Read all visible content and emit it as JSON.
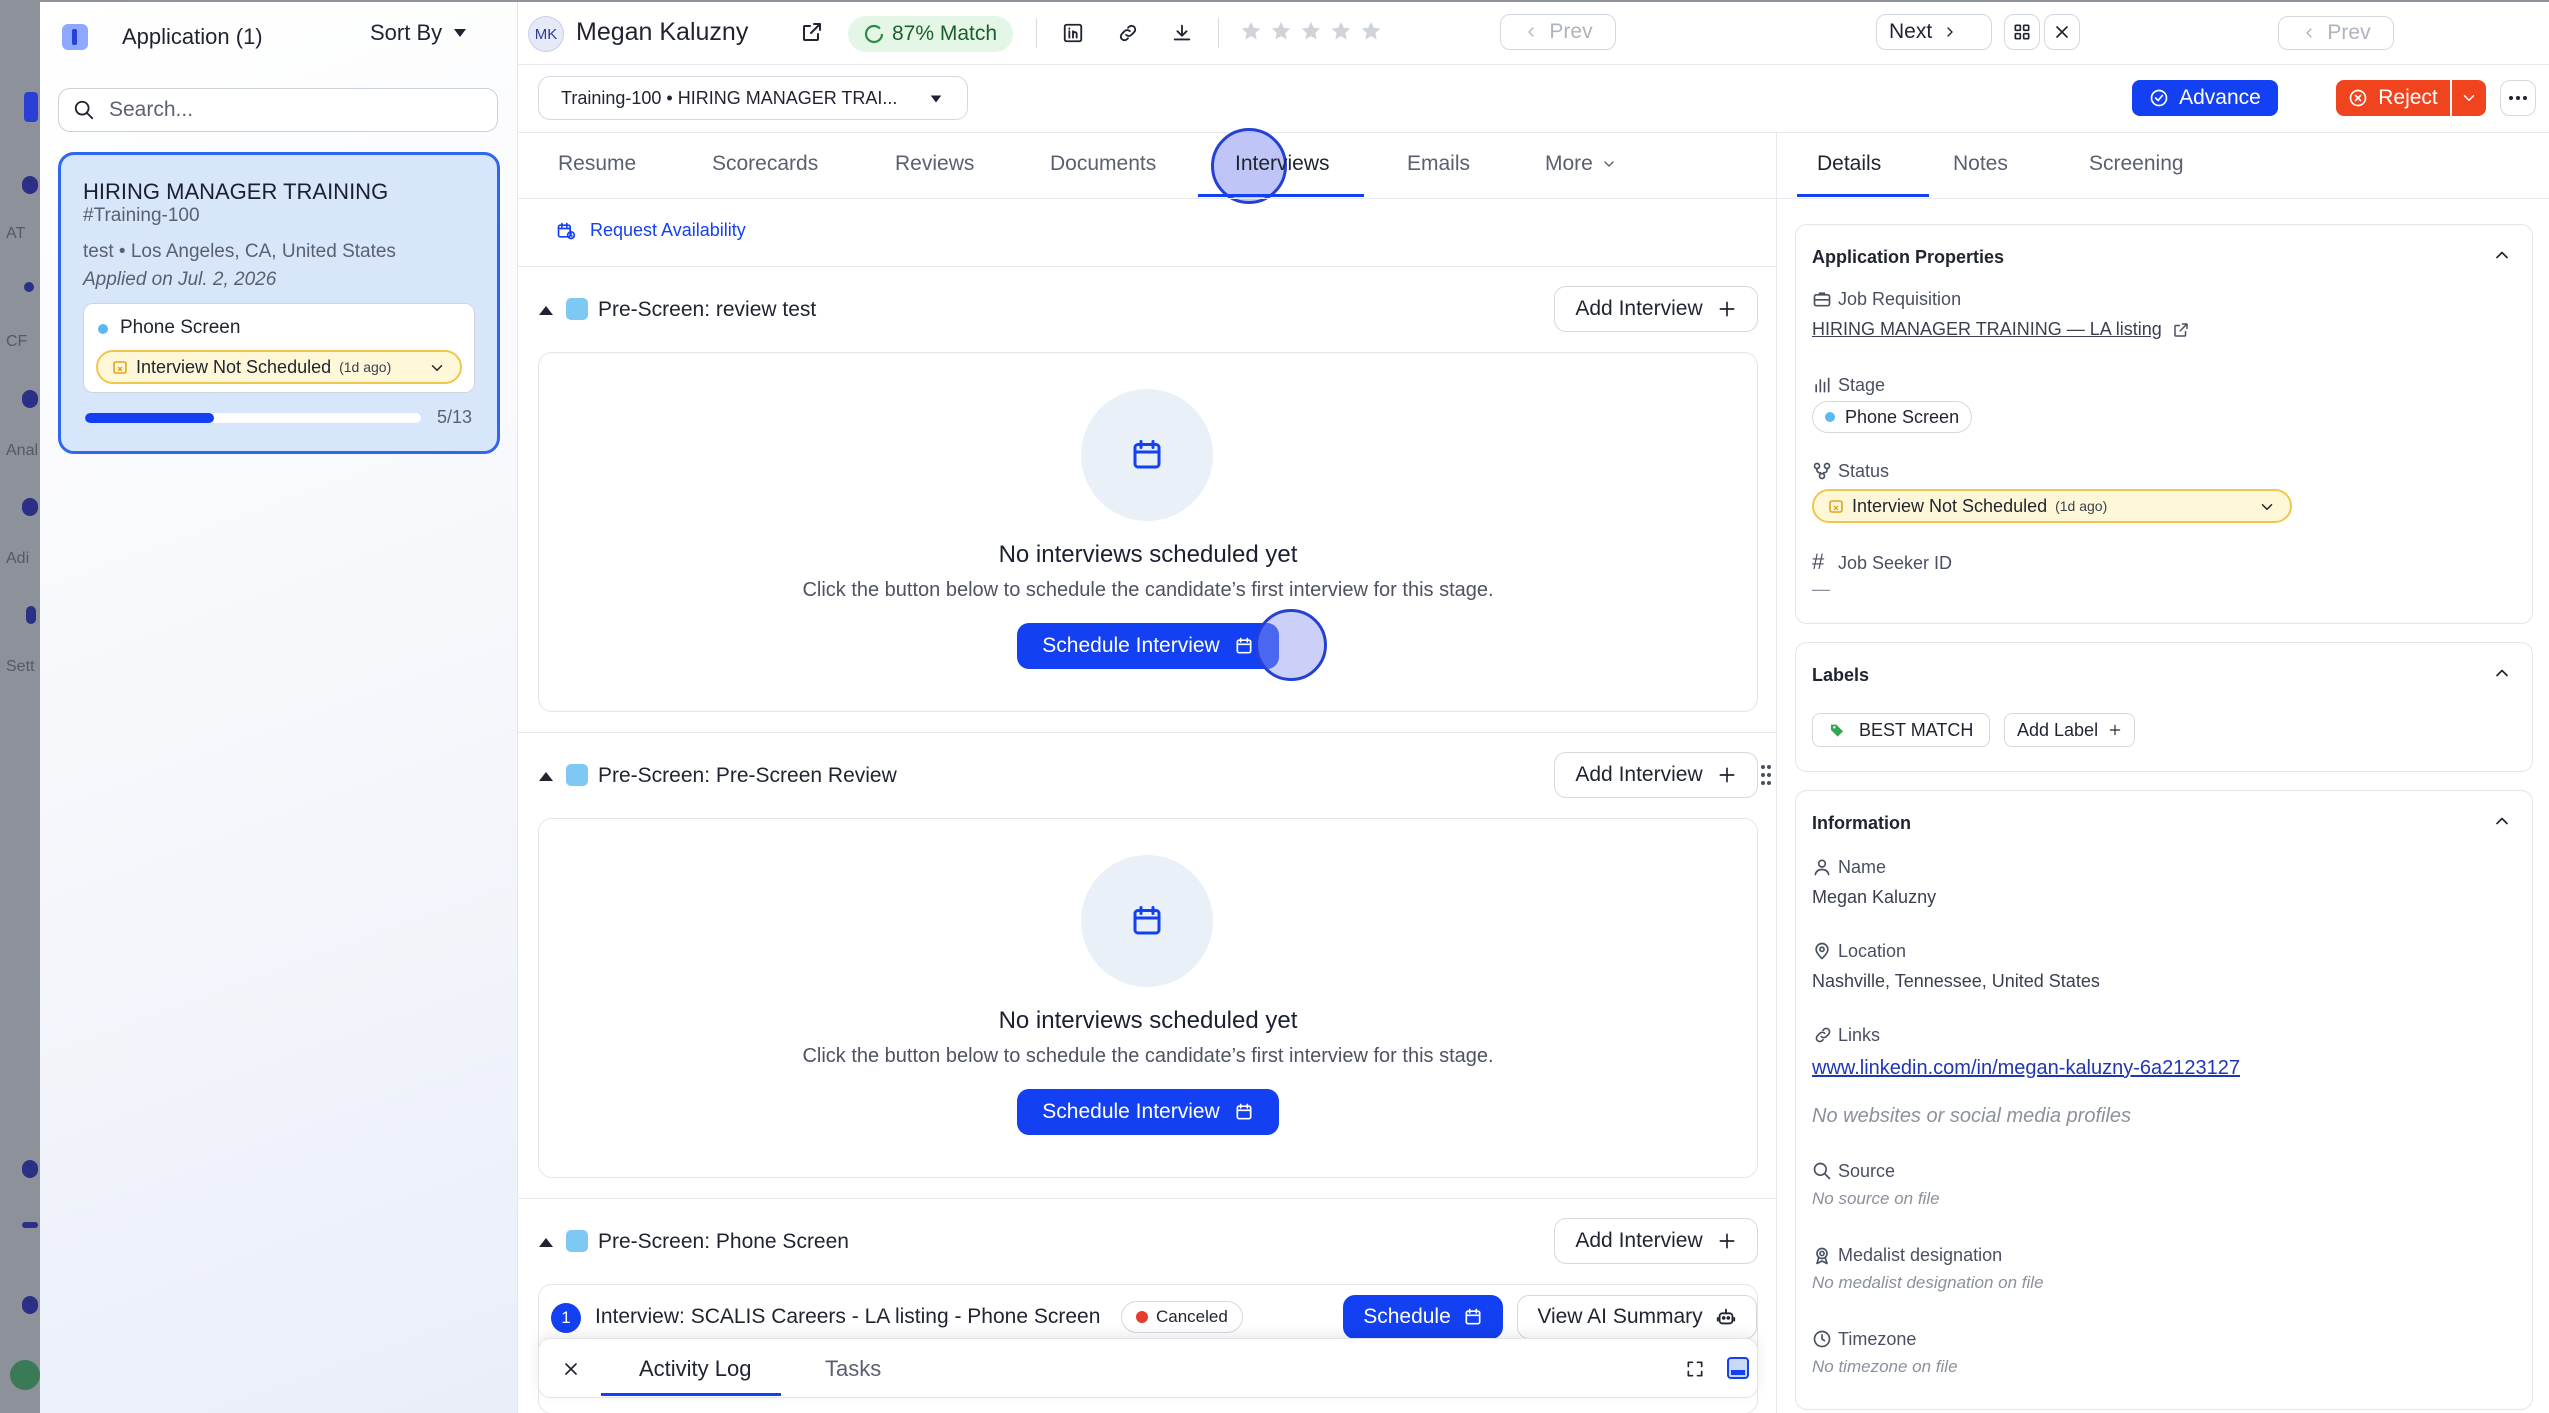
{
  "rail": {
    "labels": [
      "AT",
      "CF",
      "Anal",
      "Adi",
      "Sett"
    ]
  },
  "left": {
    "header_title": "Application (1)",
    "sort_label": "Sort By",
    "search_placeholder": "Search...",
    "app_card": {
      "title": "HIRING MANAGER TRAINING",
      "code": "#Training-100",
      "location": "test • Los Angeles, CA, United States",
      "applied": "Applied on Jul. 2, 2026",
      "stage": "Phone Screen",
      "status": "Interview Not Scheduled",
      "status_age": "(1d ago)",
      "progress_label": "5/13",
      "progress_fraction": 0.385
    }
  },
  "header": {
    "initials": "MK",
    "name": "Megan Kaluzny",
    "match": "87% Match",
    "prev_label": "Prev",
    "next_label": "Next",
    "star_count": 5,
    "job_select": "Training-100 • HIRING MANAGER TRAI...",
    "advance_label": "Advance",
    "reject_label": "Reject"
  },
  "tabs": [
    "Resume",
    "Scorecards",
    "Reviews",
    "Documents",
    "Interviews",
    "Emails",
    "More"
  ],
  "active_tab": "Interviews",
  "request_availability": "Request Availability",
  "stages": [
    {
      "title": "Pre-Screen: review test",
      "add_label": "Add Interview",
      "empty_title": "No interviews scheduled yet",
      "empty_text": "Click the button below to schedule the candidate’s first interview for this stage.",
      "schedule_label": "Schedule Interview"
    },
    {
      "title": "Pre-Screen: Pre-Screen Review",
      "add_label": "Add Interview",
      "empty_title": "No interviews scheduled yet",
      "empty_text": "Click the button below to schedule the candidate’s first interview for this stage.",
      "schedule_label": "Schedule Interview"
    },
    {
      "title": "Pre-Screen: Phone Screen",
      "add_label": "Add Interview"
    }
  ],
  "interview_row": {
    "number": "1",
    "title": "Interview: SCALIS Careers - LA listing - Phone Screen",
    "badge": "Canceled",
    "schedule_label": "Schedule",
    "summary_label": "View AI Summary"
  },
  "bottom_bar": {
    "tabs": [
      "Activity Log",
      "Tasks"
    ],
    "active": "Activity Log"
  },
  "right_tabs": [
    "Details",
    "Notes",
    "Screening"
  ],
  "right_active": "Details",
  "app_props": {
    "title": "Application Properties",
    "job_req_label": "Job Requisition",
    "job_req_value": "HIRING MANAGER TRAINING — LA listing",
    "stage_label": "Stage",
    "stage_value": "Phone Screen",
    "status_label": "Status",
    "status_value": "Interview Not Scheduled",
    "status_age": "(1d ago)",
    "seeker_label": "Job Seeker ID",
    "seeker_value": "—"
  },
  "labels_card": {
    "title": "Labels",
    "label": "BEST MATCH",
    "add_label": "Add Label"
  },
  "info": {
    "title": "Information",
    "name_label": "Name",
    "name_value": "Megan Kaluzny",
    "location_label": "Location",
    "location_value": "Nashville, Tennessee, United States",
    "links_label": "Links",
    "link_value": "www.linkedin.com/in/megan-kaluzny-6a2123127",
    "links_note": "No websites or social media profiles",
    "source_label": "Source",
    "source_value": "No source on file",
    "medalist_label": "Medalist designation",
    "medalist_value": "No medalist designation on file",
    "timezone_label": "Timezone",
    "timezone_value": "No timezone on file"
  },
  "colors": {
    "primary": "#1340f2",
    "reject": "#f0441f",
    "match_bg": "#e4f7e6",
    "status_bg": "#fff8d8",
    "status_border": "#f1c64c"
  }
}
